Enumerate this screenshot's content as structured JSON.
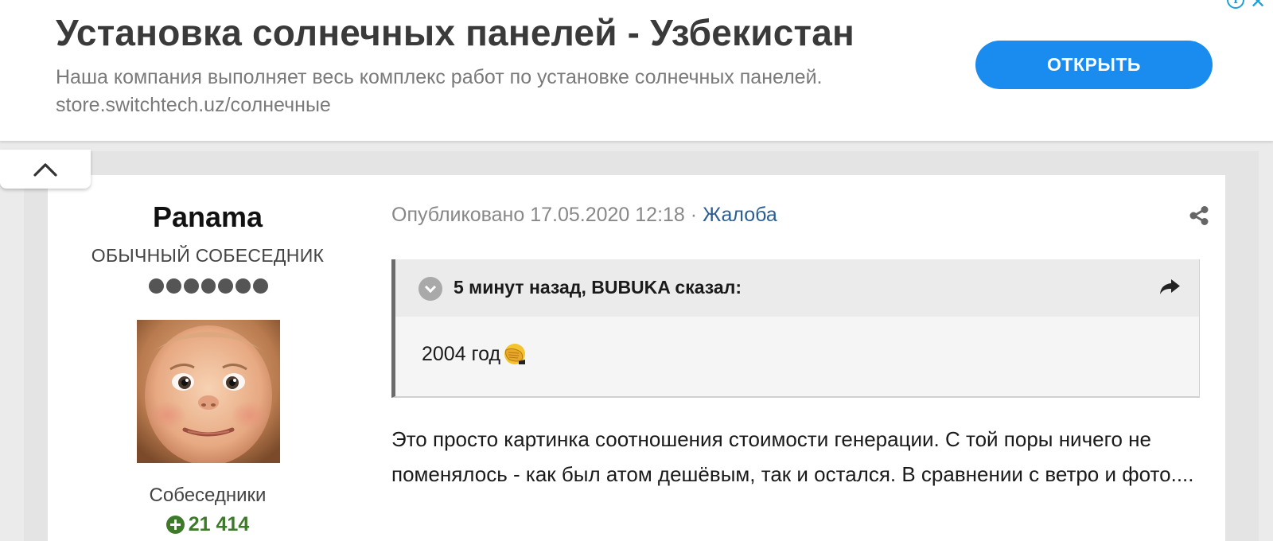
{
  "ad": {
    "title": "Установка солнечных панелей - Узбекистан",
    "description": "Наша компания выполняет весь комплекс работ по установке солнечных панелей. store.switchtech.uz/солнечные",
    "cta_label": "ОТКРЫТЬ",
    "info_icon": "i",
    "close_icon": "✕",
    "cta_color": "#1a8cf0"
  },
  "collapse_icon": "chevron-up-icon",
  "author": {
    "name": "Panama",
    "rank": "ОБЫЧНЫЙ СОБЕСЕДНИК",
    "rank_dots": 7,
    "reputation_label": "Собеседники",
    "reputation_value": "21 414",
    "reputation_color": "#3d7a2a"
  },
  "post": {
    "published_label": "Опубликовано",
    "published_date": "17.05.2020 12:18",
    "separator": "·",
    "report_label": "Жалоба",
    "share_icon": "share-icon",
    "quote": {
      "citation": "5 минут назад, BUBUKA сказал:",
      "text": "2004 год"
    },
    "body": "Это просто картинка соотношения стоимости генерации. С той поры ничего не поменялось - как был атом дешёвым, так и остался. В сравнении с ветро и фото...."
  }
}
